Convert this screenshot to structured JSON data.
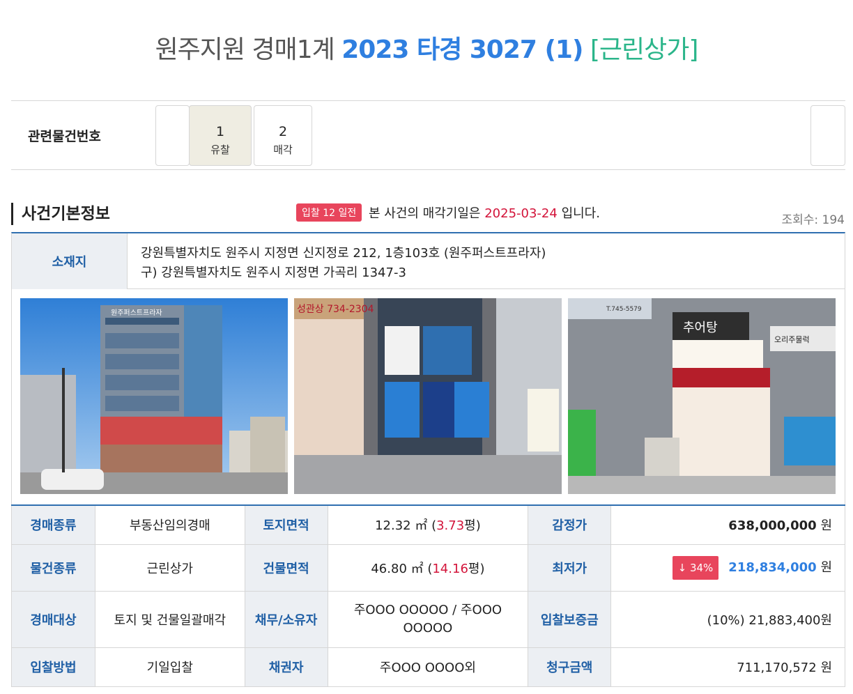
{
  "title": {
    "court": "원주지원 경매1계",
    "case_no": "2023 타경 3027 (1)",
    "kind": "[근린상가]"
  },
  "related": {
    "label": "관련물건번호",
    "items": [
      {
        "num": "1",
        "status": "유찰"
      },
      {
        "num": "2",
        "status": "매각"
      }
    ]
  },
  "section": {
    "title": "사건기본정보",
    "badge": "입찰 12 일전",
    "notice_pre": "본 사건의 매각기일은",
    "notice_date": "2025-03-24",
    "notice_post": "입니다.",
    "views": "조회수: 194"
  },
  "location": {
    "label": "소재지",
    "line1": "강원특별자치도 원주시 지정면 신지정로 212, 1층103호 (원주퍼스트프라자)",
    "line2": "구) 강원특별자치도 원주시 지정면 가곡리 1347-3"
  },
  "photos": {
    "sign1": "원주퍼스트프라자",
    "sign2": "성관상 734-2304",
    "sign3": "추어탕",
    "sign4": "오리주물럭",
    "tel": "T.745-5579"
  },
  "info": {
    "auction_type_label": "경매종류",
    "auction_type": "부동산임의경매",
    "land_area_label": "토지면적",
    "land_area_m2": "12.32 ㎡ (",
    "land_area_py": "3.73",
    "land_area_unit": "평)",
    "appraisal_label": "감정가",
    "appraisal": "638,000,000",
    "won": "원",
    "item_type_label": "물건종류",
    "item_type": "근린상가",
    "bldg_area_label": "건물면적",
    "bldg_area_m2": "46.80 ㎡ (",
    "bldg_area_py": "14.16",
    "bldg_area_unit": "평)",
    "min_price_label": "최저가",
    "discount": "↓ 34%",
    "min_price": "218,834,000",
    "target_label": "경매대상",
    "target": "토지 및 건물일괄매각",
    "debtor_label": "채무/소유자",
    "debtor": "주OOO OOOOO / 주OOO OOOOO",
    "deposit_label": "입찰보증금",
    "deposit": "(10%) 21,883,400원",
    "method_label": "입찰방법",
    "method": "기일입찰",
    "creditor_label": "채권자",
    "creditor": "주OOO OOOO외",
    "claim_label": "청구금액",
    "claim": "711,170,572 원"
  }
}
